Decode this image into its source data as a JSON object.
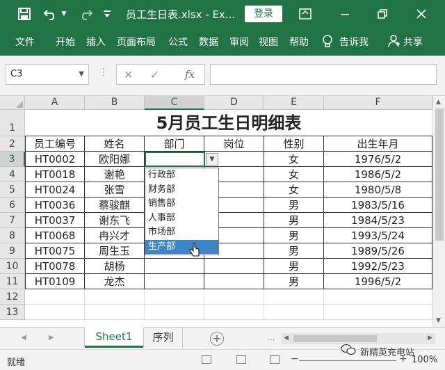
{
  "titlebar": {
    "title": "员工生日表.xlsx  -  Ex...",
    "login_label": "登录"
  },
  "menu": {
    "items": [
      "文件",
      "开始",
      "插入",
      "页面布局",
      "公式",
      "数据",
      "审阅",
      "视图",
      "帮助"
    ],
    "tell_me": "告诉我",
    "share": "共享"
  },
  "formula_bar": {
    "name_box": "C3",
    "fx_label": "fx",
    "formula_value": ""
  },
  "grid": {
    "columns": [
      "A",
      "B",
      "C",
      "D",
      "E",
      "F"
    ],
    "active_column": "C",
    "rows": [
      "1",
      "2",
      "3",
      "4",
      "5",
      "6",
      "7",
      "8",
      "9",
      "10",
      "11",
      "12",
      "13"
    ],
    "active_row": "3",
    "title": "5月员工生日明细表",
    "headers": [
      "员工编号",
      "姓名",
      "部门",
      "岗位",
      "性别",
      "出生年月"
    ],
    "records": [
      [
        "HT0002",
        "欧阳娜",
        "",
        "",
        "女",
        "1976/5/2"
      ],
      [
        "HT0018",
        "谢艳",
        "",
        "",
        "女",
        "1986/5/2"
      ],
      [
        "HT0024",
        "张雪",
        "",
        "",
        "女",
        "1980/5/8"
      ],
      [
        "HT0036",
        "蔡骏麒",
        "",
        "",
        "男",
        "1983/5/16"
      ],
      [
        "HT0037",
        "谢东飞",
        "",
        "",
        "男",
        "1984/5/23"
      ],
      [
        "HT0068",
        "冉兴才",
        "",
        "",
        "男",
        "1993/5/24"
      ],
      [
        "HT0075",
        "周生玉",
        "",
        "",
        "男",
        "1989/5/26"
      ],
      [
        "HT0078",
        "胡杨",
        "",
        "",
        "男",
        "1992/5/23"
      ],
      [
        "HT0109",
        "龙杰",
        "",
        "",
        "男",
        "1996/5/2"
      ]
    ]
  },
  "dropdown": {
    "options": [
      "行政部",
      "财务部",
      "销售部",
      "人事部",
      "市场部",
      "生产部"
    ],
    "selected": "生产部"
  },
  "sheets": {
    "tabs": [
      "Sheet1",
      "序列"
    ],
    "active": "Sheet1",
    "dots": "..."
  },
  "status": {
    "text": "就绪",
    "zoom": "100%"
  },
  "watermark": {
    "text": "新精英充电站"
  },
  "colors": {
    "excel_green": "#217346",
    "dropdown_highlight": "#3d85c6"
  }
}
